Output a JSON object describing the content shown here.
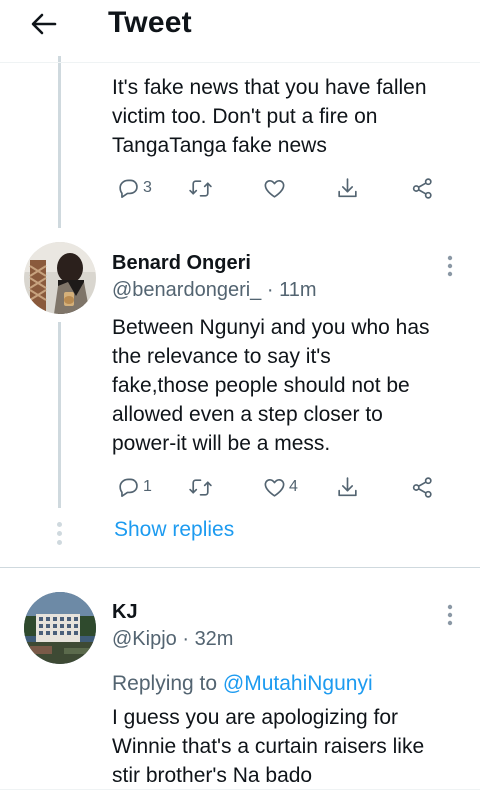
{
  "header": {
    "title": "Tweet",
    "back_icon": "arrow-left-icon"
  },
  "colors": {
    "link": "#1d9bf0",
    "muted": "#536471",
    "text": "#0f1419"
  },
  "tweet1": {
    "lines": [
      "It's fake news that you have fallen",
      "victim too. Don't put a fire on",
      "TangaTanga fake news"
    ],
    "reply_count": "3",
    "retweet_count": "",
    "like_count": ""
  },
  "tweet2": {
    "name": "Benard Ongeri",
    "handle": "@benardongeri_",
    "time": "11m",
    "lines": [
      "Between Ngunyi and you who has",
      "the relevance to say it's",
      "fake,those people should not be",
      "allowed even a step closer to",
      "power-it will be a mess."
    ],
    "reply_count": "1",
    "retweet_count": "",
    "like_count": "4"
  },
  "show_replies": "Show replies",
  "tweet3": {
    "name": "KJ",
    "handle": "@Kipjo",
    "time": "32m",
    "replying_prefix": "Replying to",
    "replying_to": "@MutahiNgunyi",
    "lines": [
      "I guess you are apologizing for",
      "Winnie that's a curtain raisers like",
      "stir brother's Na bado"
    ]
  }
}
